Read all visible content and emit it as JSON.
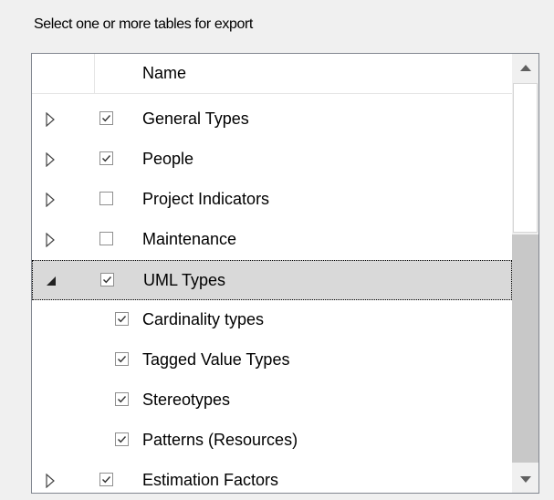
{
  "caption": "Select one or more tables for export",
  "header": {
    "name": "Name"
  },
  "rows": [
    {
      "label": "General Types",
      "checked": true,
      "expander": "collapsed",
      "level": 0
    },
    {
      "label": "People",
      "checked": true,
      "expander": "collapsed",
      "level": 0
    },
    {
      "label": "Project Indicators",
      "checked": false,
      "expander": "collapsed",
      "level": 0
    },
    {
      "label": "Maintenance",
      "checked": false,
      "expander": "collapsed",
      "level": 0
    },
    {
      "label": "UML Types",
      "checked": true,
      "expander": "expanded",
      "level": 0,
      "selected": true
    },
    {
      "label": "Cardinality types",
      "checked": true,
      "level": 1
    },
    {
      "label": "Tagged Value Types",
      "checked": true,
      "level": 1
    },
    {
      "label": "Stereotypes",
      "checked": true,
      "level": 1
    },
    {
      "label": "Patterns (Resources)",
      "checked": true,
      "level": 1
    },
    {
      "label": "Estimation Factors",
      "checked": true,
      "expander": "collapsed",
      "level": 0
    }
  ],
  "icons": {
    "collapsed": "triangle-right-outline-icon",
    "expanded": "triangle-down-filled-icon",
    "scroll_up": "arrow-up-icon",
    "scroll_down": "arrow-down-icon"
  },
  "colors": {
    "selected_row": "#d9d9d9",
    "border": "#828790",
    "check": "#333333"
  }
}
